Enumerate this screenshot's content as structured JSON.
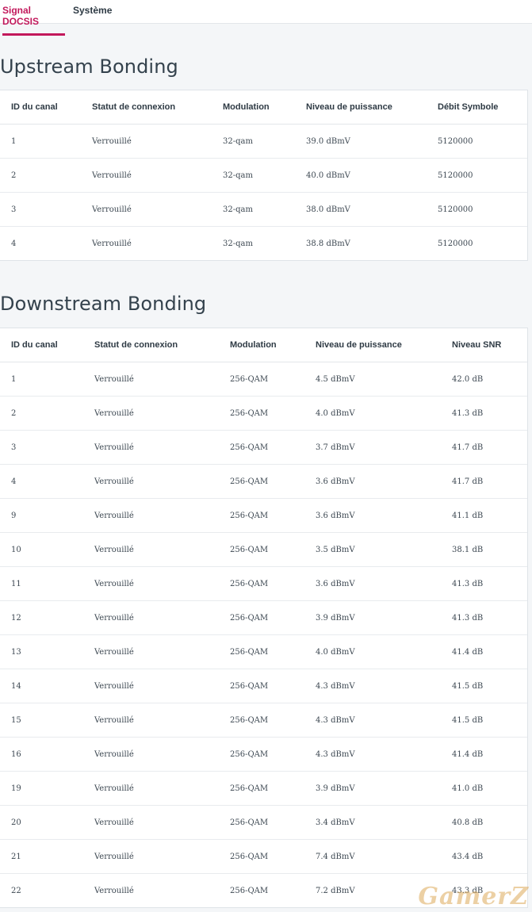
{
  "tabs": [
    {
      "label": "Signal DOCSIS",
      "active": true
    },
    {
      "label": "Système",
      "active": false
    }
  ],
  "colors": {
    "accent": "#c2185b"
  },
  "upstream": {
    "title": "Upstream Bonding",
    "columns": [
      "ID du canal",
      "Statut de connexion",
      "Modulation",
      "Niveau de puissance",
      "Débit Symbole"
    ],
    "rows": [
      [
        "1",
        "Verrouillé",
        "32-qam",
        "39.0 dBmV",
        "5120000"
      ],
      [
        "2",
        "Verrouillé",
        "32-qam",
        "40.0 dBmV",
        "5120000"
      ],
      [
        "3",
        "Verrouillé",
        "32-qam",
        "38.0 dBmV",
        "5120000"
      ],
      [
        "4",
        "Verrouillé",
        "32-qam",
        "38.8 dBmV",
        "5120000"
      ]
    ]
  },
  "downstream": {
    "title": "Downstream Bonding",
    "columns": [
      "ID du canal",
      "Statut de connexion",
      "Modulation",
      "Niveau de puissance",
      "Niveau SNR"
    ],
    "rows": [
      [
        "1",
        "Verrouillé",
        "256-QAM",
        "4.5 dBmV",
        "42.0 dB"
      ],
      [
        "2",
        "Verrouillé",
        "256-QAM",
        "4.0 dBmV",
        "41.3 dB"
      ],
      [
        "3",
        "Verrouillé",
        "256-QAM",
        "3.7 dBmV",
        "41.7 dB"
      ],
      [
        "4",
        "Verrouillé",
        "256-QAM",
        "3.6 dBmV",
        "41.7 dB"
      ],
      [
        "9",
        "Verrouillé",
        "256-QAM",
        "3.6 dBmV",
        "41.1 dB"
      ],
      [
        "10",
        "Verrouillé",
        "256-QAM",
        "3.5 dBmV",
        "38.1 dB"
      ],
      [
        "11",
        "Verrouillé",
        "256-QAM",
        "3.6 dBmV",
        "41.3 dB"
      ],
      [
        "12",
        "Verrouillé",
        "256-QAM",
        "3.9 dBmV",
        "41.3 dB"
      ],
      [
        "13",
        "Verrouillé",
        "256-QAM",
        "4.0 dBmV",
        "41.4 dB"
      ],
      [
        "14",
        "Verrouillé",
        "256-QAM",
        "4.3 dBmV",
        "41.5 dB"
      ],
      [
        "15",
        "Verrouillé",
        "256-QAM",
        "4.3 dBmV",
        "41.5 dB"
      ],
      [
        "16",
        "Verrouillé",
        "256-QAM",
        "4.3 dBmV",
        "41.4 dB"
      ],
      [
        "19",
        "Verrouillé",
        "256-QAM",
        "3.9 dBmV",
        "41.0 dB"
      ],
      [
        "20",
        "Verrouillé",
        "256-QAM",
        "3.4 dBmV",
        "40.8 dB"
      ],
      [
        "21",
        "Verrouillé",
        "256-QAM",
        "7.4 dBmV",
        "43.4 dB"
      ],
      [
        "22",
        "Verrouillé",
        "256-QAM",
        "7.2 dBmV",
        "43.3 dB"
      ]
    ]
  },
  "watermark": "GamerZ"
}
